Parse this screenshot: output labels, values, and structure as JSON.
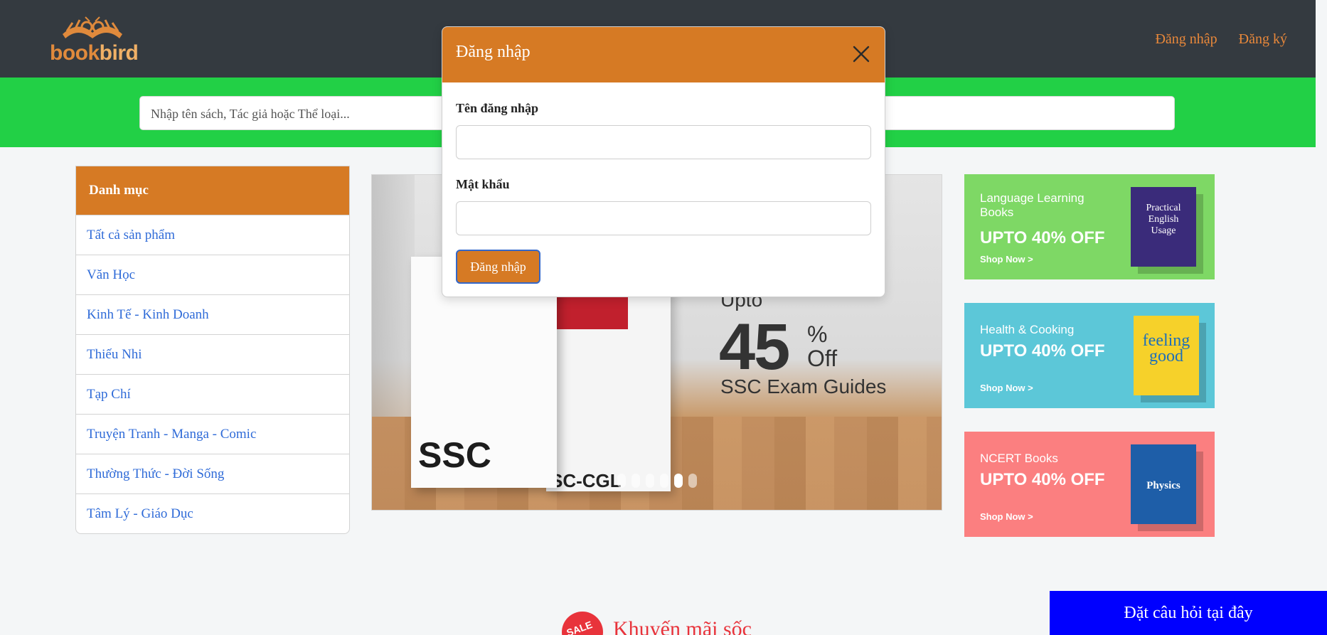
{
  "header": {
    "logo": "bookbird",
    "logo_part1": "book",
    "logo_part2": "bird",
    "login_link": "Đăng nhập",
    "register_link": "Đăng ký"
  },
  "search": {
    "placeholder": "Nhập tên sách, Tác giả hoặc Thể loại..."
  },
  "sidebar": {
    "heading": "Danh mục",
    "items": [
      {
        "label": "Tất cả sản phẩm"
      },
      {
        "label": "Văn Học"
      },
      {
        "label": "Kinh Tế - Kinh Doanh"
      },
      {
        "label": "Thiếu Nhi"
      },
      {
        "label": "Tạp Chí"
      },
      {
        "label": "Truyện Tranh - Manga - Comic"
      },
      {
        "label": "Thường Thức - Đời Sống"
      },
      {
        "label": "Tâm Lý - Giáo Dục"
      }
    ]
  },
  "banner": {
    "upto": "Upto",
    "percent": "45",
    "percent_sign": "%",
    "off": "Off",
    "subtitle": "SSC Exam Guides",
    "book1_title": "SSC",
    "book2_title": "SC-CGL",
    "slide_count": 6,
    "active_slide": 5
  },
  "promos": [
    {
      "title": "Language Learning Books",
      "offer": "UPTO 40% OFF",
      "cta": "Shop Now >",
      "book_text": "Practical English Usage",
      "color": "#7ed865"
    },
    {
      "title": "Health & Cooking",
      "offer": "UPTO 40% OFF",
      "cta": "Shop Now >",
      "book_text": "feeling good",
      "color": "#5cc7d8"
    },
    {
      "title": "NCERT Books",
      "offer": "UPTO 40% OFF",
      "cta": "Shop Now >",
      "book_text": "Physics",
      "color": "#fb7f80"
    }
  ],
  "modal": {
    "title": "Đăng nhập",
    "username_label": "Tên đăng nhập",
    "username_value": "",
    "password_label": "Mật khẩu",
    "password_value": "",
    "submit_label": "Đăng nhập"
  },
  "promo_section": {
    "badge": "SALE",
    "title": "Khuyến mãi sốc"
  },
  "ask_button": "Đặt câu hỏi tại đây",
  "colors": {
    "header_bg": "#343a40",
    "accent": "#d67a24",
    "search_band": "#22d046",
    "link": "#2f6bd8",
    "ask_button": "#0000ff"
  }
}
